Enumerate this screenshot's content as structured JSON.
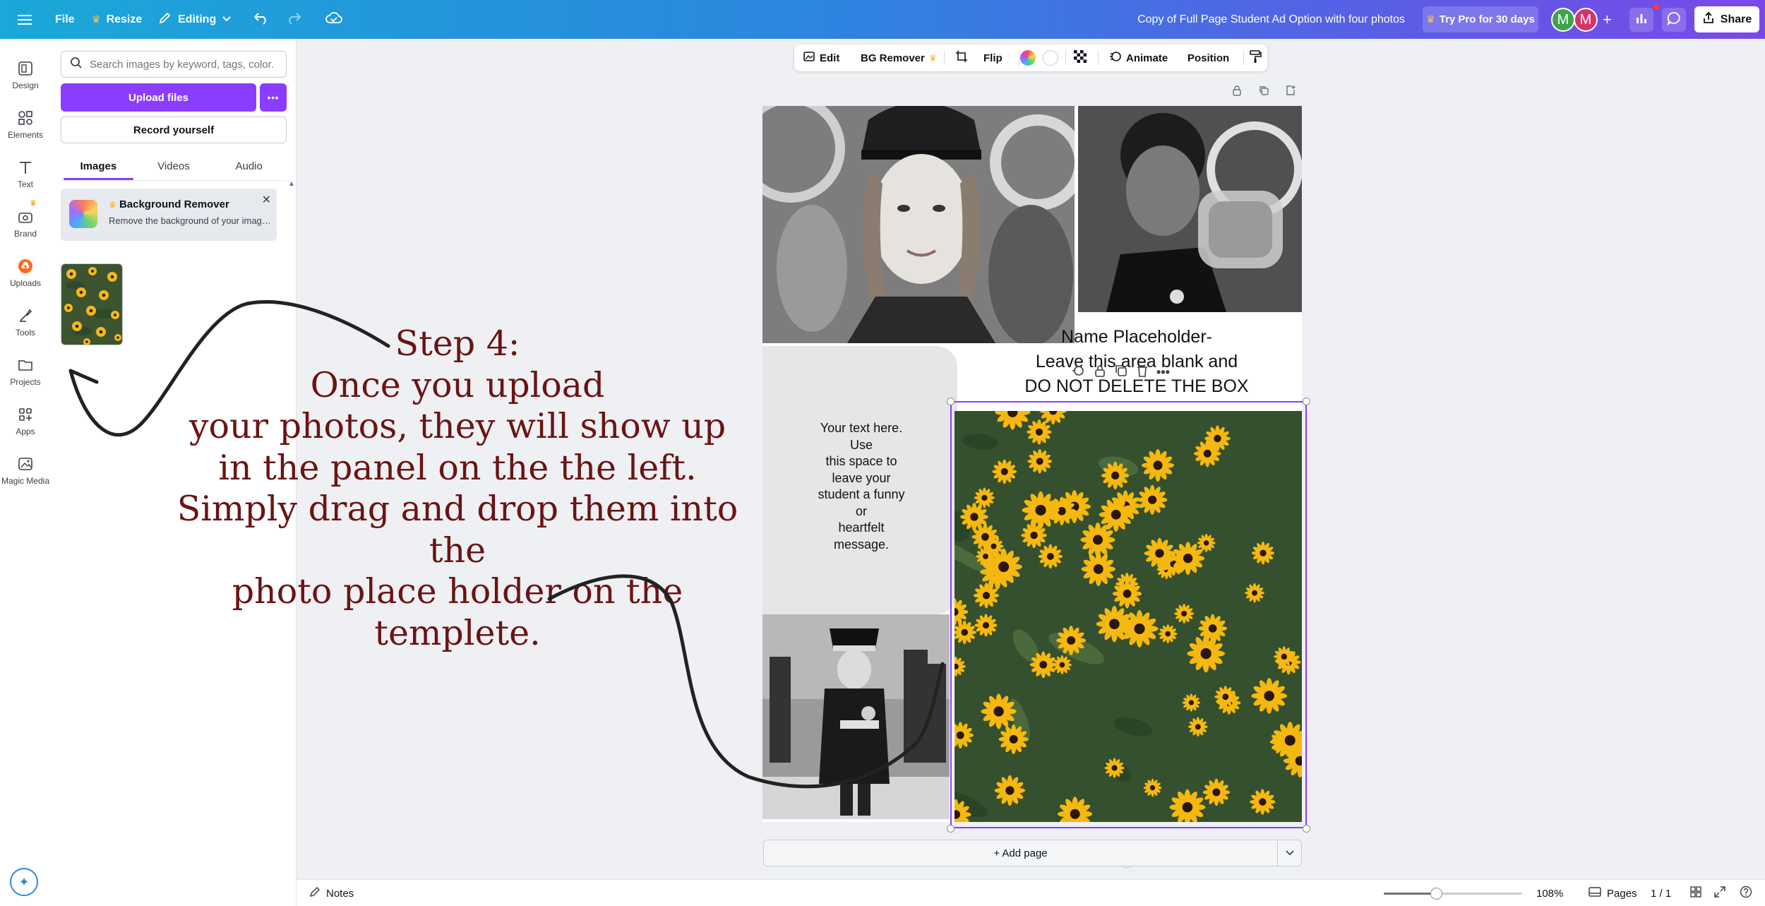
{
  "topbar": {
    "file_label": "File",
    "resize_label": "Resize",
    "editing_label": "Editing",
    "doc_title": "Copy of Full Page Student Ad Option with four photos",
    "pro_label": "Try Pro for 30 days",
    "avatar1": "M",
    "avatar2": "M",
    "share_label": "Share"
  },
  "rail": {
    "items": [
      {
        "label": "Design"
      },
      {
        "label": "Elements"
      },
      {
        "label": "Text"
      },
      {
        "label": "Brand"
      },
      {
        "label": "Uploads"
      },
      {
        "label": "Tools"
      },
      {
        "label": "Projects"
      },
      {
        "label": "Apps"
      },
      {
        "label": "Magic Media"
      }
    ]
  },
  "panel": {
    "search_placeholder": "Search images by keyword, tags, color...",
    "upload_label": "Upload files",
    "more_label": "•••",
    "record_label": "Record yourself",
    "tabs": [
      {
        "label": "Images"
      },
      {
        "label": "Videos"
      },
      {
        "label": "Audio"
      }
    ],
    "promo_title": "Background Remover",
    "promo_desc": "Remove the background of your images",
    "promo_close": "✕"
  },
  "toolbar": {
    "edit_label": "Edit",
    "bgremover_label": "BG Remover",
    "flip_label": "Flip",
    "animate_label": "Animate",
    "position_label": "Position"
  },
  "canvas": {
    "your_text": "Your text here.\nUse\nthis space to\nleave your\nstudent a funny\nor\nheartfelt\nmessage.",
    "name_placeholder": "Name Placeholder-\nLeave this area blank and\nDO NOT DELETE THE BOX",
    "step_text": "Step 4:\nOnce you upload\nyour photos, they will show up\nin the panel on the the left.\nSimply drag and drop them into the\nphoto place holder on the\ntemplete.",
    "add_page_label": "+ Add page"
  },
  "bottombar": {
    "notes_label": "Notes",
    "zoom_label": "108%",
    "zoom_fraction": 0.38,
    "pages_label": "Pages",
    "page_count": "1 / 1"
  },
  "colors": {
    "accent": "#8b3dff",
    "step_text": "#6a1414"
  }
}
